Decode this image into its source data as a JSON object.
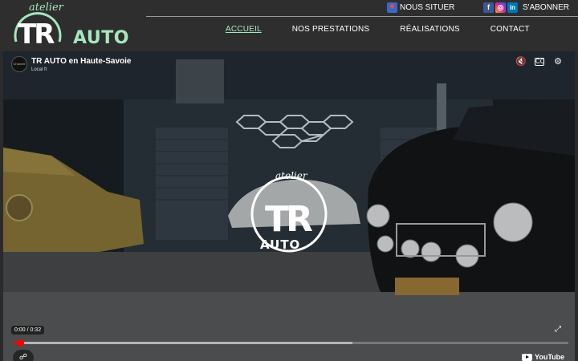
{
  "logo": {
    "script": "atelier",
    "monogram": "TR",
    "word": "AUTO"
  },
  "topbar": {
    "locate_label": "NOUS SITUER",
    "subscribe_label": "S'ABONNER",
    "social_icons": [
      "facebook-icon",
      "instagram-icon",
      "linkedin-icon"
    ]
  },
  "nav": {
    "items": [
      {
        "label": "ACCUEIL",
        "active": true
      },
      {
        "label": "NOS PRESTATIONS",
        "active": false
      },
      {
        "label": "RÉALISATIONS",
        "active": false
      },
      {
        "label": "CONTACT",
        "active": false
      }
    ]
  },
  "video": {
    "title": "TR AUTO en Haute-Savoie",
    "channel": "Local fr",
    "avatar_text": "Channel",
    "time": "0:00 / 0:32",
    "played_fraction": 0.01,
    "buffered_fraction": 0.61,
    "brand": "YouTube",
    "watermark": {
      "script": "atelier",
      "monogram": "TR",
      "word": "AUTO"
    },
    "controls": [
      "mute-icon",
      "captions-icon",
      "settings-icon"
    ]
  },
  "colors": {
    "accent": "#a6e7bf",
    "header_bg": "#2e2e2e",
    "progress": "#ff0000"
  }
}
